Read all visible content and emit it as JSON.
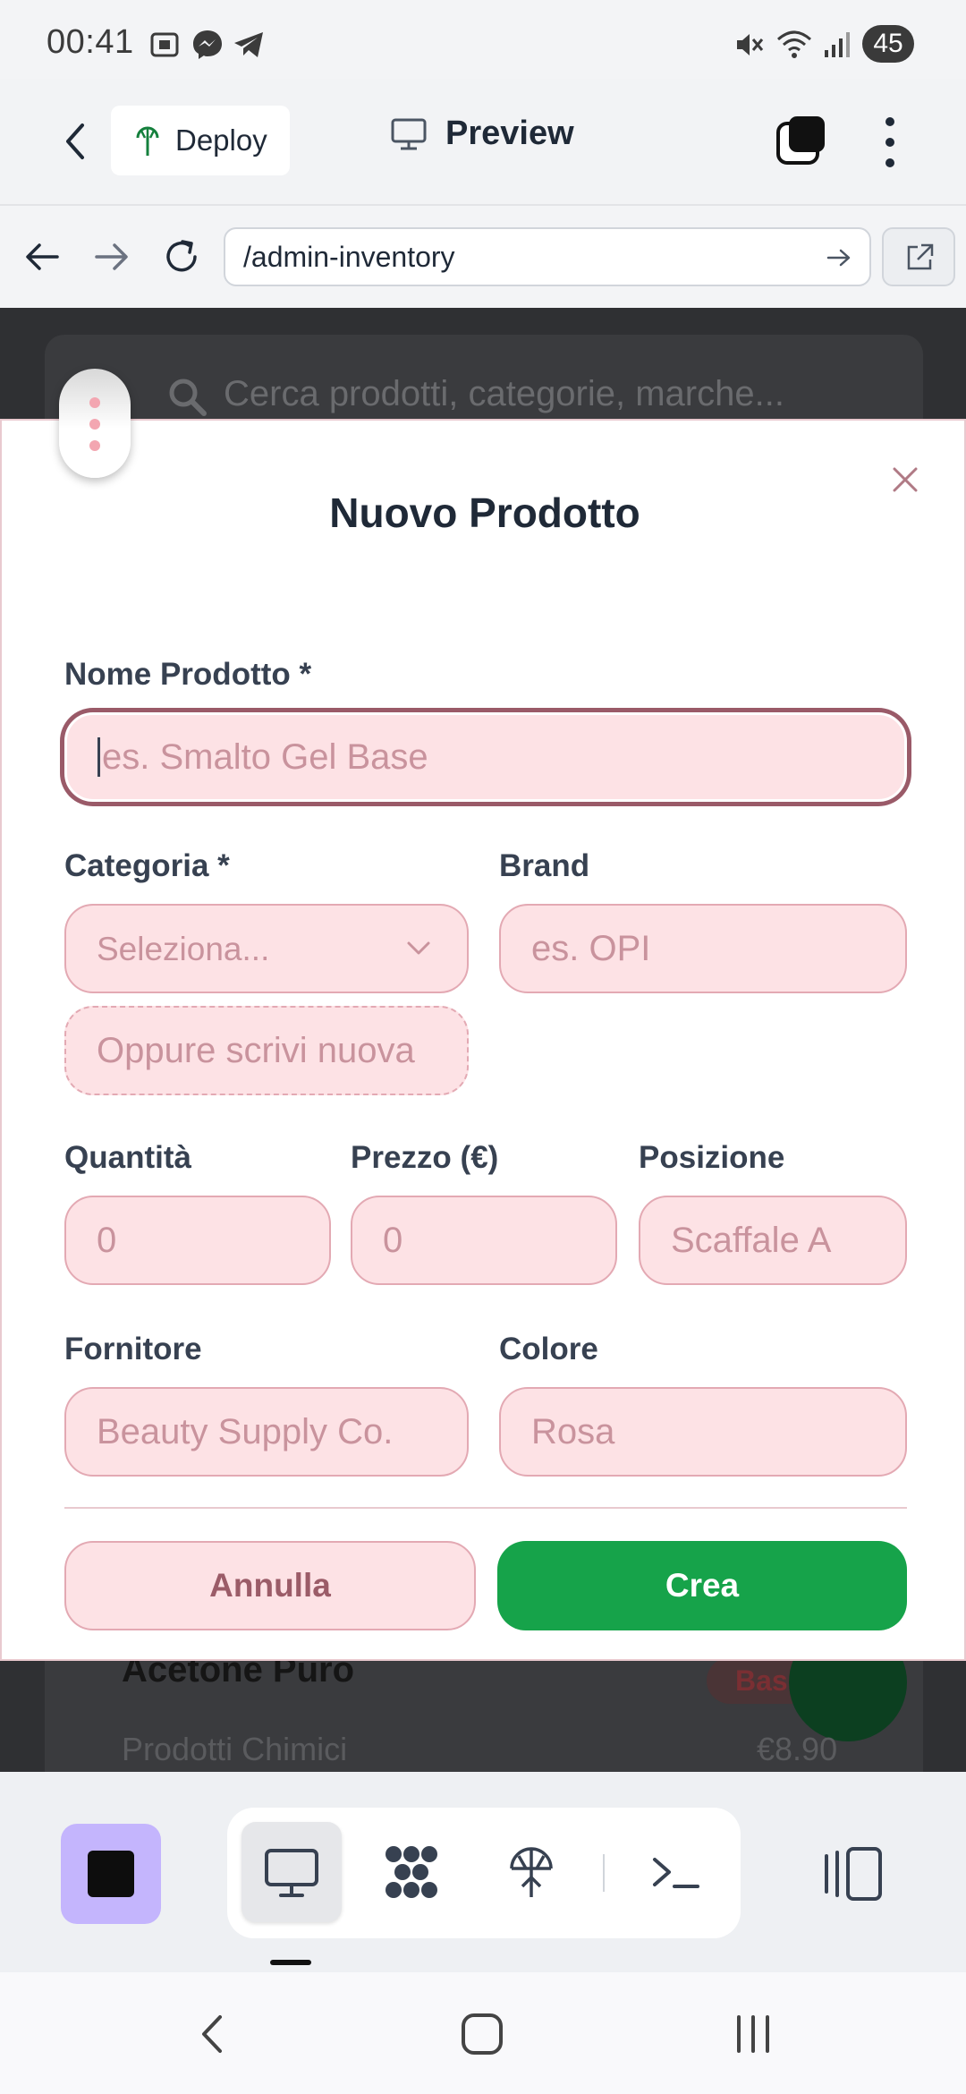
{
  "status_bar": {
    "time": "00:41",
    "battery": "45",
    "icons": [
      "screenshot-icon",
      "messenger-icon",
      "telegram-icon",
      "mute-icon",
      "wifi-icon",
      "signal-icon"
    ]
  },
  "toolbar": {
    "deploy_label": "Deploy",
    "preview_label": "Preview"
  },
  "browser": {
    "url": "/admin-inventory"
  },
  "background_page": {
    "search_placeholder": "Cerca prodotti, categorie, marche...",
    "card": {
      "title": "Acetone Puro",
      "category": "Prodotti Chimici",
      "price": "€8.90",
      "badge": "Bass"
    }
  },
  "modal": {
    "title": "Nuovo Prodotto",
    "fields": {
      "name": {
        "label": "Nome Prodotto *",
        "placeholder": "es. Smalto Gel Base"
      },
      "category": {
        "label": "Categoria *",
        "selected": "Seleziona...",
        "new_placeholder": "Oppure scrivi nuova"
      },
      "brand": {
        "label": "Brand",
        "placeholder": "es. OPI"
      },
      "quantity": {
        "label": "Quantità",
        "placeholder": "0"
      },
      "price": {
        "label": "Prezzo (€)",
        "placeholder": "0"
      },
      "position": {
        "label": "Posizione",
        "placeholder": "Scaffale A"
      },
      "supplier": {
        "label": "Fornitore",
        "placeholder": "Beauty Supply Co."
      },
      "color": {
        "label": "Colore",
        "placeholder": "Rosa"
      }
    },
    "cancel_label": "Annulla",
    "create_label": "Crea"
  },
  "colors": {
    "accent_green": "#16a34a",
    "input_bg": "#fde2e5",
    "input_border": "#e3a9b3",
    "stop_button": "#c4b5fd"
  }
}
